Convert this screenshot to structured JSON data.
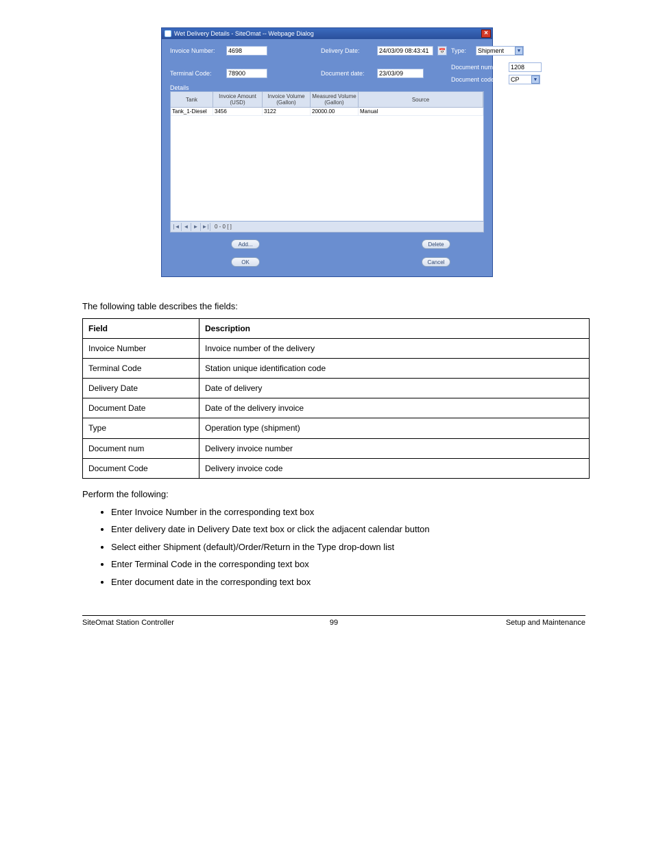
{
  "dialog": {
    "title": "Wet Delivery Details - SiteOmat -- Webpage Dialog",
    "close_x": "×",
    "labels": {
      "invoice_number": "Invoice Number:",
      "terminal_code": "Terminal Code:",
      "delivery_date": "Delivery Date:",
      "document_date": "Document date:",
      "type": "Type:",
      "document_num": "Document num:",
      "document_code": "Document code:",
      "details": "Details"
    },
    "values": {
      "invoice_number": "4698",
      "terminal_code": "78900",
      "delivery_date": "24/03/09 08:43:41",
      "document_date": "23/03/09",
      "type": "Shipment",
      "document_num": "1208",
      "document_code": "CP"
    },
    "grid": {
      "headers": {
        "tank": "Tank",
        "invoice_amount": "Invoice Amount (USD)",
        "invoice_volume": "Invoice Volume (Gallon)",
        "measured_volume": "Measured Volume (Gallon)",
        "source": "Source"
      },
      "rows": [
        {
          "tank": "Tank_1-Diesel",
          "invoice_amount": "3456",
          "invoice_volume": "3122",
          "measured_volume": "20000.00",
          "source": "Manual"
        }
      ]
    },
    "pager": {
      "first": "|◄",
      "prev": "◄",
      "next": "►",
      "last": "►|",
      "range": "0 - 0  [  ]"
    },
    "buttons": {
      "add": "Add...",
      "delete": "Delete",
      "ok": "OK",
      "cancel": "Cancel"
    }
  },
  "doc": {
    "intro": "The following table describes the fields:",
    "table": {
      "h_field": "Field",
      "h_desc": "Description",
      "rows": [
        {
          "field": "Invoice Number",
          "desc": "Invoice number of the delivery"
        },
        {
          "field": "Terminal Code",
          "desc": "Station unique identification code"
        },
        {
          "field": "Delivery Date",
          "desc": "Date of delivery"
        },
        {
          "field": "Document Date",
          "desc": "Date of the delivery invoice"
        },
        {
          "field": "Type",
          "desc": "Operation type (shipment)"
        },
        {
          "field": "Document num",
          "desc": "Delivery invoice number"
        },
        {
          "field": "Document Code",
          "desc": "Delivery invoice code"
        }
      ]
    },
    "para1": "Perform the following:",
    "bullets": [
      "Enter Invoice Number in the corresponding text box",
      "Enter delivery date in Delivery Date text box or click the adjacent calendar button",
      "Select either Shipment (default)/Order/Return in the Type drop-down list",
      "Enter Terminal Code in the corresponding text box",
      "Enter document date in the corresponding text box"
    ],
    "footer": {
      "left": "SiteOmat Station Controller",
      "center": "99",
      "right": "Setup and Maintenance"
    }
  }
}
